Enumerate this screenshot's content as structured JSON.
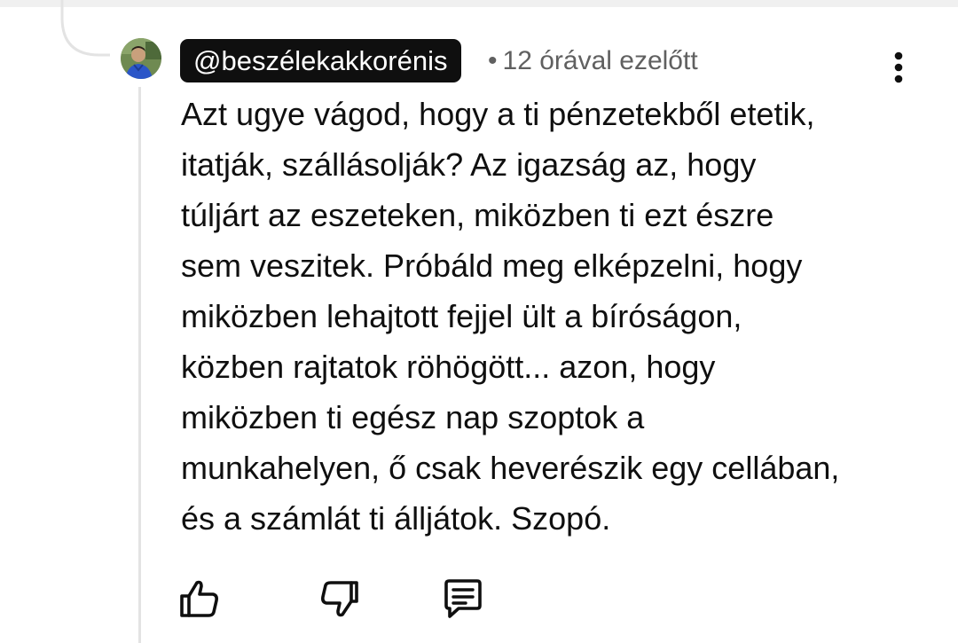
{
  "comment": {
    "author": "@beszélekakkorénis",
    "separator": "•",
    "time": "12 órával ezelőtt",
    "text_lines": [
      "Azt ugye vágod, hogy a ti pénzetekből etetik,",
      "itatják, szállásolják? Az igazság az, hogy",
      "túljárt az eszeteken, miközben ti ezt észre",
      "sem veszitek. Próbáld meg elképzelni, hogy",
      "miközben lehajtott fejjel ült a bíróságon,",
      "közben rajtatok röhögött... azon, hogy",
      "miközben ti egész nap szoptok a",
      "munkahelyen, ő csak heverészik egy cellában,",
      "és a számlát ti álljátok. Szopó."
    ]
  },
  "icons": {
    "avatar": "profile-photo",
    "more": "more-vert-icon",
    "like": "thumbs-up-icon",
    "dislike": "thumbs-down-icon",
    "reply": "comment-reply-icon"
  },
  "colors": {
    "author_chip_bg": "#0f0f0f",
    "author_chip_text": "#ffffff",
    "meta_text": "#606060",
    "body_text": "#0f0f0f",
    "thread_line": "#e3e3e3"
  }
}
